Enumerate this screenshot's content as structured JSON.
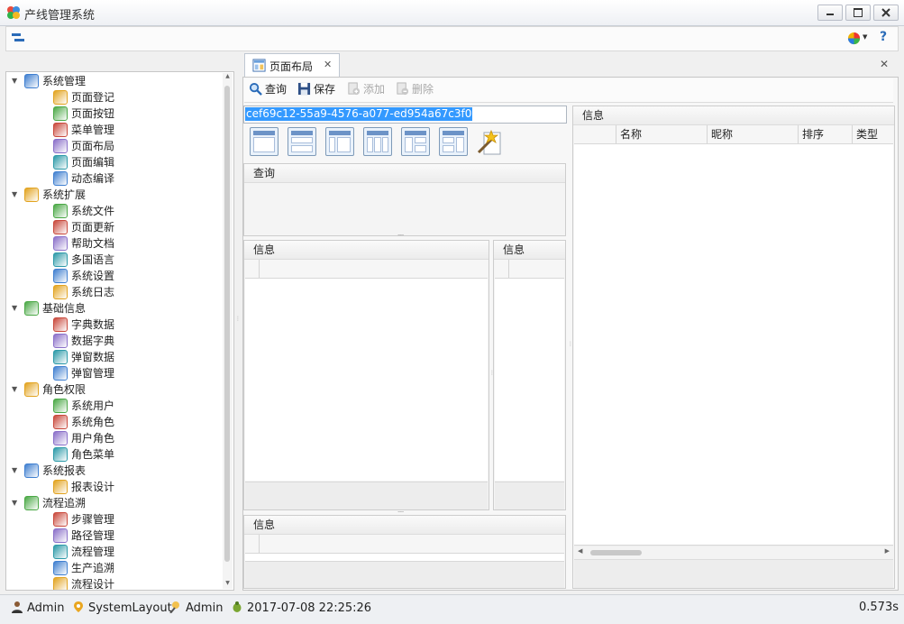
{
  "window": {
    "title": "产线管理系统"
  },
  "toolbar": {
    "help_label": "?"
  },
  "tree": {
    "items": [
      {
        "label": "系统管理",
        "level": 0,
        "icon": "tools-icon"
      },
      {
        "label": "页面登记",
        "level": 1,
        "icon": "page-register-icon"
      },
      {
        "label": "页面按钮",
        "level": 1,
        "icon": "hammer-icon"
      },
      {
        "label": "菜单管理",
        "level": 1,
        "icon": "menu-icon"
      },
      {
        "label": "页面布局",
        "level": 1,
        "icon": "layout-icon"
      },
      {
        "label": "页面编辑",
        "level": 1,
        "icon": "page-edit-icon"
      },
      {
        "label": "动态编译",
        "level": 1,
        "icon": "compile-icon"
      },
      {
        "label": "系统扩展",
        "level": 0,
        "icon": "puzzle-icon"
      },
      {
        "label": "系统文件",
        "level": 1,
        "icon": "file-icon"
      },
      {
        "label": "页面更新",
        "level": 1,
        "icon": "up-arrow-icon"
      },
      {
        "label": "帮助文档",
        "level": 1,
        "icon": "help-doc-icon"
      },
      {
        "label": "多国语言",
        "level": 1,
        "icon": "globe-icon"
      },
      {
        "label": "系统设置",
        "level": 1,
        "icon": "gear-icon"
      },
      {
        "label": "系统日志",
        "level": 1,
        "icon": "log-icon"
      },
      {
        "label": "基础信息",
        "level": 0,
        "icon": "box-icon"
      },
      {
        "label": "字典数据",
        "level": 1,
        "icon": "grass-icon"
      },
      {
        "label": "数据字典",
        "level": 1,
        "icon": "burger-icon"
      },
      {
        "label": "弹窗数据",
        "level": 1,
        "icon": "dog-icon"
      },
      {
        "label": "弹窗管理",
        "level": 1,
        "icon": "swirl-icon"
      },
      {
        "label": "角色权限",
        "level": 0,
        "icon": "key-icon"
      },
      {
        "label": "系统用户",
        "level": 1,
        "icon": "user-icon"
      },
      {
        "label": "系统角色",
        "level": 1,
        "icon": "role-icon"
      },
      {
        "label": "用户角色",
        "level": 1,
        "icon": "users-icon"
      },
      {
        "label": "角色菜单",
        "level": 1,
        "icon": "role-menu-icon"
      },
      {
        "label": "系统报表",
        "level": 0,
        "icon": "report-icon"
      },
      {
        "label": "报表设计",
        "level": 1,
        "icon": "chart-icon"
      },
      {
        "label": "流程追溯",
        "level": 0,
        "icon": "flow-icon"
      },
      {
        "label": "步骤管理",
        "level": 1,
        "icon": "step-icon"
      },
      {
        "label": "路径管理",
        "level": 1,
        "icon": "path-icon"
      },
      {
        "label": "流程管理",
        "level": 1,
        "icon": "org-chart-icon"
      },
      {
        "label": "生产追溯",
        "level": 1,
        "icon": "trace-icon"
      },
      {
        "label": "流程设计",
        "level": 1,
        "icon": "design-icon"
      }
    ]
  },
  "tab": {
    "label": "页面布局",
    "close": "✕"
  },
  "actions": {
    "query": "查询",
    "save": "保存",
    "add": "添加",
    "delete": "删除"
  },
  "layout_id": "cef69c12-55a9-4576-a077-ed954a67c3f0",
  "panels": {
    "query_title": "查询",
    "info_left_title": "信息",
    "info_mid_title": "信息",
    "info_bottom_title": "信息",
    "info_right_title": "信息"
  },
  "right_grid": {
    "columns": [
      "名称",
      "昵称",
      "排序",
      "类型"
    ]
  },
  "status": {
    "user": "Admin",
    "page": "SystemLayout",
    "operator": "Admin",
    "datetime": "2017-07-08 22:25:26",
    "elapsed": "0.573s"
  },
  "colors": {
    "selection": "#3399ff",
    "accent": "#2a6bb8"
  }
}
